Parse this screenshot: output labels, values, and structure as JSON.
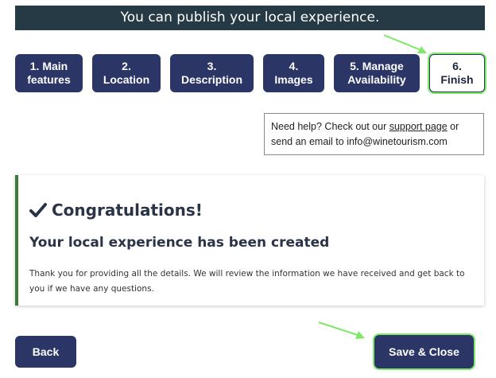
{
  "banner": {
    "text": "You can publish your local experience."
  },
  "steps": [
    {
      "line1": "1. Main",
      "line2": "features"
    },
    {
      "line1": "2.",
      "line2": "Location"
    },
    {
      "line1": "3.",
      "line2": "Description"
    },
    {
      "line1": "4.",
      "line2": "Images"
    },
    {
      "line1": "5. Manage",
      "line2": "Availability"
    },
    {
      "line1": "6.",
      "line2": "Finish"
    }
  ],
  "help": {
    "prefix": "Need help? Check out our ",
    "link": "support page",
    "middle": " or send an email to ",
    "email": "info@winetourism.com"
  },
  "card": {
    "title": "Congratulations!",
    "subtitle": "Your local experience has been created",
    "body": "Thank you for providing all the details. We will review the information we have received and get back to you if we have any questions.",
    "accent_color": "#3d7a3e"
  },
  "buttons": {
    "back_label": "Back",
    "save_label": "Save & Close"
  },
  "colors": {
    "primary": "#2b3566",
    "banner": "#253a45",
    "highlight": "#7ee86b"
  }
}
